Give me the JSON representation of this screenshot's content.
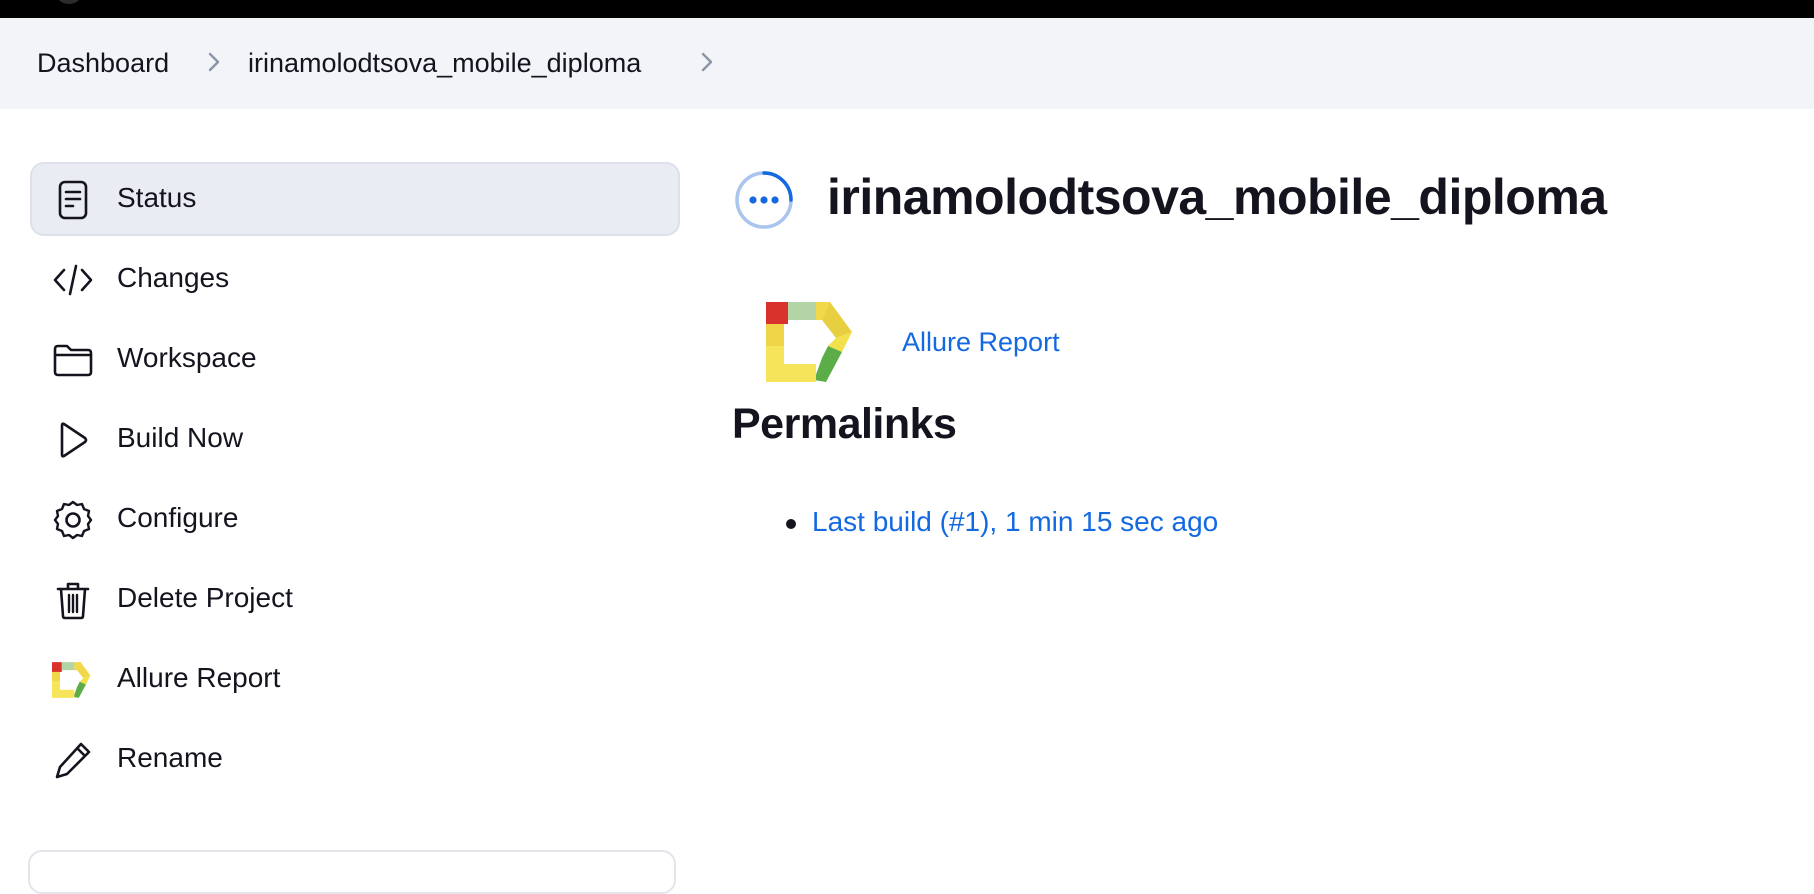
{
  "breadcrumbs": [
    {
      "label": "Dashboard"
    },
    {
      "label": "irinamolodtsova_mobile_diploma"
    }
  ],
  "sidebar": {
    "items": [
      {
        "label": "Status",
        "icon": "document-icon",
        "active": true
      },
      {
        "label": "Changes",
        "icon": "code-icon"
      },
      {
        "label": "Workspace",
        "icon": "folder-icon"
      },
      {
        "label": "Build Now",
        "icon": "play-icon"
      },
      {
        "label": "Configure",
        "icon": "gear-icon"
      },
      {
        "label": "Delete Project",
        "icon": "trash-icon"
      },
      {
        "label": "Allure Report",
        "icon": "allure-logo-icon"
      },
      {
        "label": "Rename",
        "icon": "pencil-icon"
      }
    ]
  },
  "main": {
    "title": "irinamolodtsova_mobile_diploma",
    "status_icon": "in-progress-icon",
    "allure_report_label": "Allure Report",
    "permalinks_heading": "Permalinks",
    "permalinks": [
      {
        "label": "Last build (#1), 1 min 15 sec ago"
      }
    ]
  },
  "colors": {
    "link": "#1469e0",
    "breadcrumb_bg": "#f3f4f7",
    "active_item_bg": "#e9ecf3",
    "status_blue": "#1469e0"
  }
}
